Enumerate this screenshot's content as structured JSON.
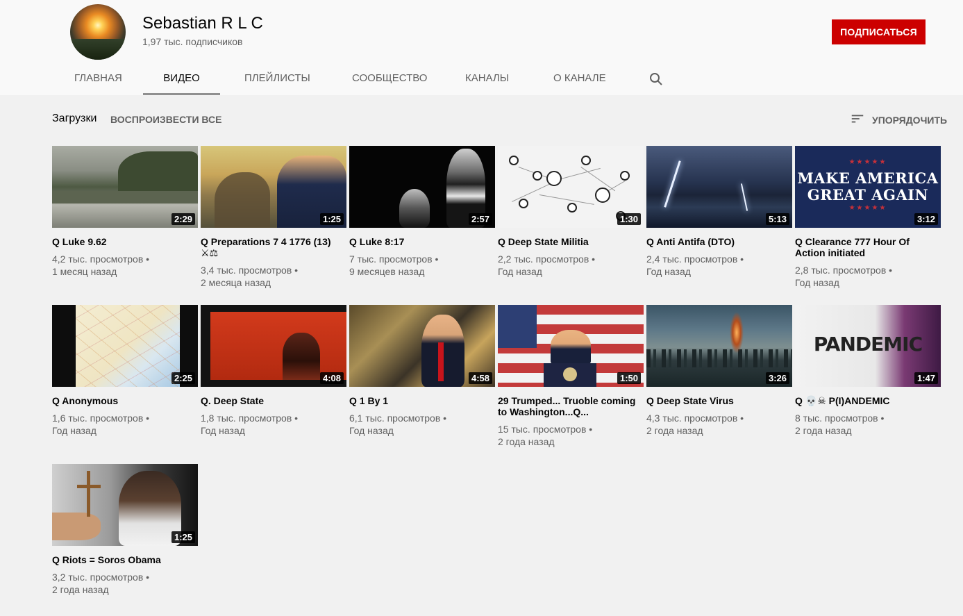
{
  "channel": {
    "name": "Sebastian R L C",
    "subscribers": "1,97 тыс. подписчиков",
    "subscribe_label": "ПОДПИСАТЬСЯ",
    "avatar_icon": "sunset-landscape-avatar"
  },
  "tabs": [
    {
      "label": "ГЛАВНАЯ",
      "active": false
    },
    {
      "label": "ВИДЕО",
      "active": true
    },
    {
      "label": "ПЛЕЙЛИСТЫ",
      "active": false
    },
    {
      "label": "СООБЩЕСТВО",
      "active": false
    },
    {
      "label": "КАНАЛЫ",
      "active": false
    },
    {
      "label": "О КАНАЛЕ",
      "active": false
    }
  ],
  "subheader": {
    "uploads_label": "Загрузки",
    "play_all_label": "ВОСПРОИЗВЕСТИ ВСЕ",
    "sort_label": "УПОРЯДОЧИТЬ"
  },
  "colors": {
    "accent": "#cc0000",
    "page_bg": "#f1f1f1",
    "header_bg": "#f9f9f9",
    "meta_text": "#606060"
  },
  "videos": [
    {
      "title": "Q Luke 9.62",
      "duration": "2:29",
      "views": "4,2 тыс. просмотров •",
      "age": "1 месяц назад"
    },
    {
      "title": "Q Preparations 7 4 1776 (13) ⚔⚖",
      "duration": "1:25",
      "views": "3,4 тыс. просмотров •",
      "age": "2 месяца назад"
    },
    {
      "title": "Q Luke 8:17",
      "duration": "2:57",
      "views": "7 тыс. просмотров •",
      "age": "9 месяцев назад"
    },
    {
      "title": "Q Deep State Militia",
      "duration": "1:30",
      "views": "2,2 тыс. просмотров •",
      "age": "Год назад"
    },
    {
      "title": "Q Anti Antifa (DTO)",
      "duration": "5:13",
      "views": "2,4 тыс. просмотров •",
      "age": "Год назад"
    },
    {
      "title": "Q Clearance 777 Hour Of Action initiated",
      "duration": "3:12",
      "views": "2,8 тыс. просмотров •",
      "age": "Год назад"
    },
    {
      "title": "Q Anonymous",
      "duration": "2:25",
      "views": "1,6 тыс. просмотров •",
      "age": "Год назад"
    },
    {
      "title": "Q. Deep State",
      "duration": "4:08",
      "views": "1,8 тыс. просмотров •",
      "age": "Год назад"
    },
    {
      "title": "Q 1 By 1",
      "duration": "4:58",
      "views": "6,1 тыс. просмотров •",
      "age": "Год назад"
    },
    {
      "title": "29 Trumped... Truoble coming to Washington...Q...",
      "duration": "1:50",
      "views": "15 тыс. просмотров •",
      "age": "2 года назад"
    },
    {
      "title": "Q Deep State Virus",
      "duration": "3:26",
      "views": "4,3 тыс. просмотров •",
      "age": "2 года назад"
    },
    {
      "title": "Q 💀☠ P(I)ANDEMIC",
      "duration": "1:47",
      "views": "8 тыс. просмотров •",
      "age": "2 года назад"
    },
    {
      "title": "Q Riots = Soros Obama",
      "duration": "1:25",
      "views": "3,2 тыс. просмотров •",
      "age": "2 года назад"
    }
  ],
  "thumb_text": {
    "maga_stars": "★★★★★",
    "maga_line1": "MAKE AMERICA",
    "maga_line2": "GREAT AGAIN",
    "pandemic_word": "PANDEMIC"
  }
}
